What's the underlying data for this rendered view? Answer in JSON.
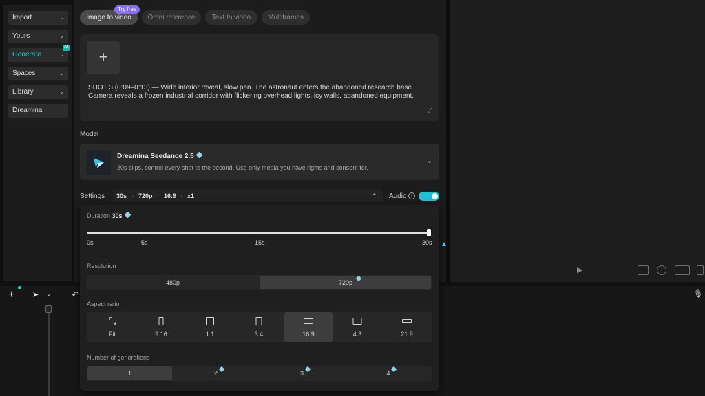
{
  "sidebar": {
    "items": [
      {
        "label": "Import",
        "chevron": "⌄"
      },
      {
        "label": "Yours",
        "chevron": "⌄"
      },
      {
        "label": "Generate",
        "chevron": "⌄",
        "badge": "AI"
      },
      {
        "label": "Spaces",
        "chevron": "⌄"
      },
      {
        "label": "Library",
        "chevron": "⌄"
      },
      {
        "label": "Dreamina"
      }
    ]
  },
  "tabs": [
    {
      "label": "Image to video"
    },
    {
      "label": "Omni reference"
    },
    {
      "label": "Text to video"
    },
    {
      "label": "Multiframes"
    }
  ],
  "try_badge": "Try free",
  "prompt": {
    "add_icon": "+",
    "text": "SHOT 3 (0:09–0:13) — Wide interior reveal, slow pan. The astronaut enters the abandoned research base. Camera reveals a frozen industrial corridor with flickering overhead lights, icy walls, abandoned equipment,",
    "expand_icon": "⤢"
  },
  "model": {
    "section_label": "Model",
    "name": "Dreamina Seedance 2.5",
    "description": "30s clips, control every shot to the second. Use only media you have rights and consent for.",
    "chevron": "⌄"
  },
  "settings": {
    "label": "Settings",
    "duration": "30s",
    "resolution": "720p",
    "ratio": "16:9",
    "count": "x1",
    "sep": "·",
    "chevron": "⌃",
    "audio_label": "Audio",
    "info_icon": "i",
    "audio_on": true
  },
  "popup": {
    "duration_label": "Duration",
    "duration_value": "30s",
    "slider": {
      "min": 0,
      "max": 30,
      "value": 30
    },
    "ticks": [
      "0s",
      "5s",
      "15s",
      "30s"
    ],
    "resolution_label": "Resolution",
    "resolutions": [
      {
        "label": "480p",
        "selected": false
      },
      {
        "label": "720p",
        "selected": true
      }
    ],
    "aspect_label": "Aspect ratio",
    "aspects": [
      {
        "label": "Fit",
        "selected": false
      },
      {
        "label": "9:16",
        "selected": false
      },
      {
        "label": "1:1",
        "selected": false
      },
      {
        "label": "3:4",
        "selected": false
      },
      {
        "label": "16:9",
        "selected": true
      },
      {
        "label": "4:3",
        "selected": false
      },
      {
        "label": "21:9",
        "selected": false
      }
    ],
    "generations_label": "Number of generations",
    "generations": [
      {
        "label": "1",
        "selected": true
      },
      {
        "label": "2",
        "selected": false
      },
      {
        "label": "3",
        "selected": false
      },
      {
        "label": "4",
        "selected": false
      }
    ]
  },
  "timeline": {
    "add_icon": "+",
    "select_icon": "➤",
    "dropdown_icon": "⌄",
    "undo_icon": "↶",
    "mic_icon": "🎙"
  },
  "preview": {
    "play_icon": "▶"
  },
  "colors": {
    "accent": "#2ad1c9",
    "toggle": "#1fc1d6",
    "badge": "#8a6ff0"
  }
}
